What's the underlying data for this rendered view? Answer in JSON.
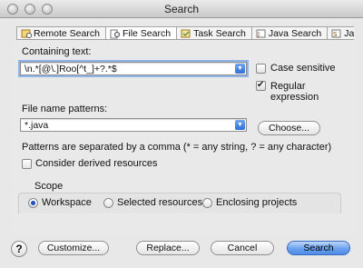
{
  "window": {
    "title": "Search"
  },
  "tabs": [
    {
      "label": "Remote Search",
      "icon": "remote-search-icon"
    },
    {
      "label": "File Search",
      "icon": "file-search-icon",
      "active": true
    },
    {
      "label": "Task Search",
      "icon": "task-search-icon"
    },
    {
      "label": "Java Search",
      "icon": "java-search-icon"
    },
    {
      "label": "JavaS",
      "icon": "javascript-search-icon"
    }
  ],
  "containing_text": {
    "label": "Containing text:",
    "value": "\\n.*[@\\.]Roo[^t_]+?.*$",
    "case_sensitive_label": "Case sensitive",
    "case_sensitive": false,
    "regex_label": "Regular expression",
    "regex": true
  },
  "file_patterns": {
    "label": "File name patterns:",
    "value": "*.java",
    "choose_label": "Choose...",
    "hint": "Patterns are separated by a comma (* = any string, ? = any character)",
    "derived_label": "Consider derived resources",
    "derived": false
  },
  "scope": {
    "label": "Scope",
    "options": [
      "Workspace",
      "Selected resources",
      "Enclosing projects"
    ],
    "selected": "Workspace"
  },
  "buttons": {
    "customize": "Customize...",
    "replace": "Replace...",
    "cancel": "Cancel",
    "search": "Search"
  },
  "colors": {
    "accent": "#4f8be6",
    "focus": "#8db5ec"
  }
}
